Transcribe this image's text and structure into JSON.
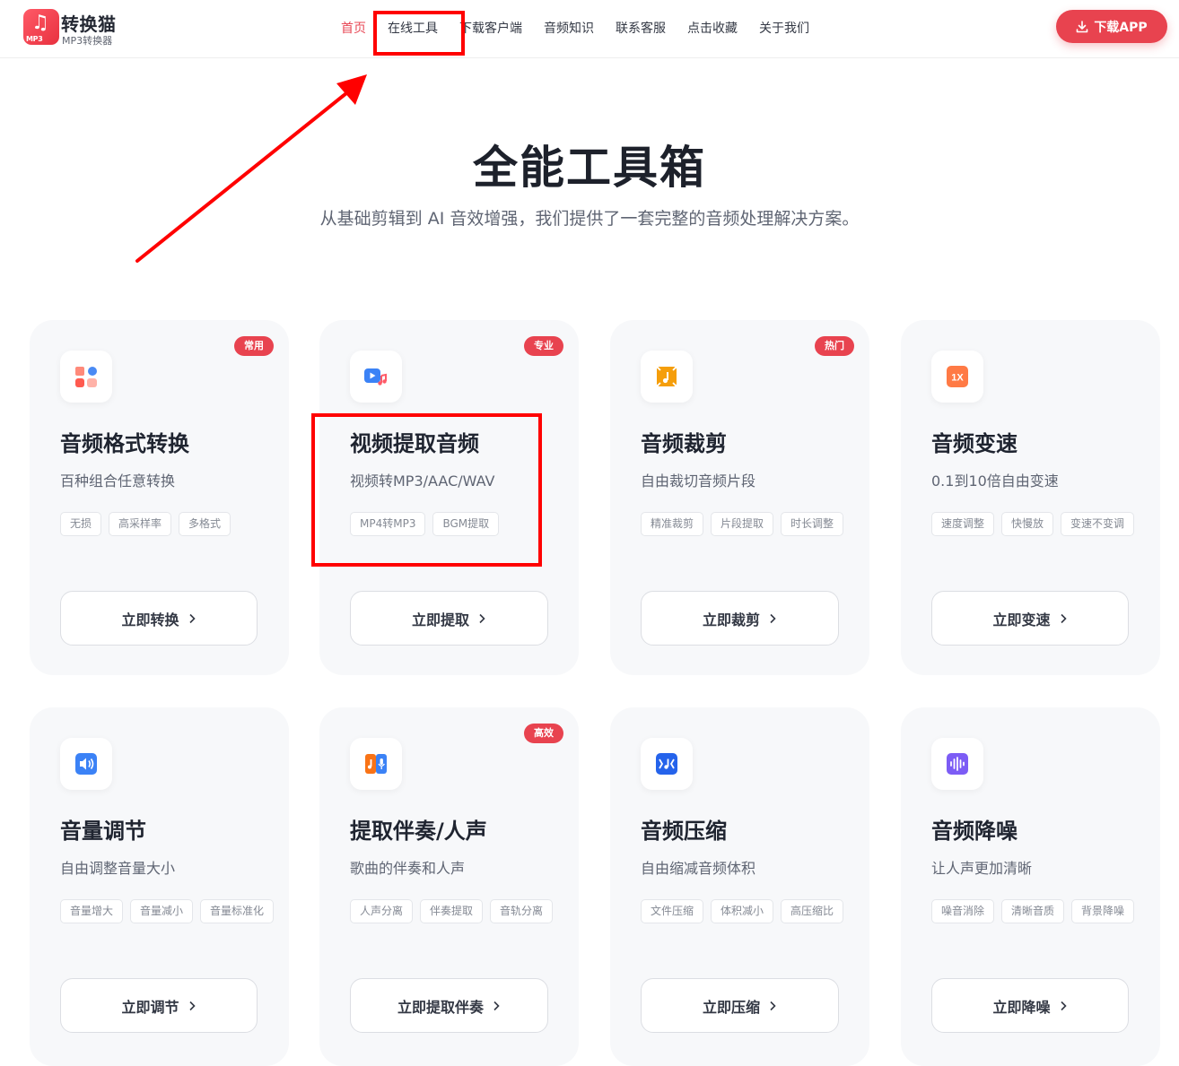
{
  "header": {
    "logo": {
      "mp3_text": "MP3",
      "icon": "music-note-icon",
      "color": "#e8434f"
    },
    "brand_name": "转换猫",
    "brand_sub": "MP3转换器",
    "nav": [
      {
        "label": "首页",
        "active": true
      },
      {
        "label": "在线工具",
        "active": false
      },
      {
        "label": "下载客户端",
        "active": false
      },
      {
        "label": "音频知识",
        "active": false
      },
      {
        "label": "联系客服",
        "active": false
      },
      {
        "label": "点击收藏",
        "active": false
      },
      {
        "label": "关于我们",
        "active": false
      }
    ],
    "download_label": "下载APP"
  },
  "hero": {
    "title": "全能工具箱",
    "subtitle": "从基础剪辑到 AI 音效增强，我们提供了一套完整的音频处理解决方案。"
  },
  "cards": [
    {
      "icon": "format-convert-icon",
      "icon_color": "#ff6b5b",
      "badge": "常用",
      "title": "音频格式转换",
      "desc": "百种组合任意转换",
      "tags": [
        "无损",
        "高采样率",
        "多格式"
      ],
      "button": "立即转换"
    },
    {
      "icon": "video-to-audio-icon",
      "icon_color": "#3b82f6",
      "badge": "专业",
      "title": "视频提取音频",
      "desc": "视频转MP3/AAC/WAV",
      "tags": [
        "MP4转MP3",
        "BGM提取"
      ],
      "button": "立即提取"
    },
    {
      "icon": "audio-trim-icon",
      "icon_color": "#f59e0b",
      "badge": "热门",
      "title": "音频裁剪",
      "desc": "自由裁切音频片段",
      "tags": [
        "精准裁剪",
        "片段提取",
        "时长调整"
      ],
      "button": "立即裁剪"
    },
    {
      "icon": "speed-1x-icon",
      "icon_color": "#ff7a45",
      "badge": "",
      "title": "音频变速",
      "desc": "0.1到10倍自由变速",
      "tags": [
        "速度调整",
        "快慢放",
        "变速不变调"
      ],
      "button": "立即变速"
    },
    {
      "icon": "volume-icon",
      "icon_color": "#3b82f6",
      "badge": "",
      "title": "音量调节",
      "desc": "自由调整音量大小",
      "tags": [
        "音量增大",
        "音量减小",
        "音量标准化"
      ],
      "button": "立即调节"
    },
    {
      "icon": "vocal-separation-icon",
      "icon_color": "#f97316",
      "badge": "高效",
      "title": "提取伴奏/人声",
      "desc": "歌曲的伴奏和人声",
      "tags": [
        "人声分离",
        "伴奏提取",
        "音轨分离"
      ],
      "button": "立即提取伴奏"
    },
    {
      "icon": "audio-compress-icon",
      "icon_color": "#2563eb",
      "badge": "",
      "title": "音频压缩",
      "desc": "自由缩减音频体积",
      "tags": [
        "文件压缩",
        "体积减小",
        "高压缩比"
      ],
      "button": "立即压缩"
    },
    {
      "icon": "noise-reduction-icon",
      "icon_color": "#7c5cf5",
      "badge": "",
      "title": "音频降噪",
      "desc": "让人声更加清晰",
      "tags": [
        "噪音消除",
        "清晰音质",
        "背景降噪"
      ],
      "button": "立即降噪"
    }
  ],
  "annotations": {
    "color": "#ff0000"
  }
}
